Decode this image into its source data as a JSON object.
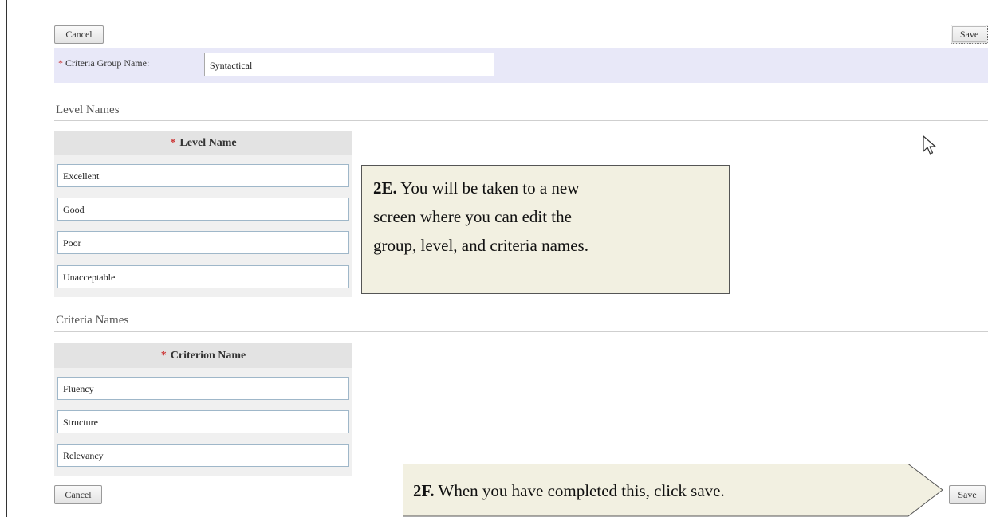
{
  "top": {
    "cancel_label": "Cancel",
    "save_label": "Save"
  },
  "group": {
    "label": "Criteria Group Name:",
    "value": "Syntactical",
    "required_mark": "*"
  },
  "levels": {
    "section_title": "Level Names",
    "column_header": "Level Name",
    "required_mark": "*",
    "rows": [
      "Excellent",
      "Good",
      "Poor",
      "Unacceptable"
    ]
  },
  "criteria": {
    "section_title": "Criteria Names",
    "column_header": "Criterion Name",
    "required_mark": "*",
    "rows": [
      "Fluency",
      "Structure",
      "Relevancy"
    ]
  },
  "bottom": {
    "cancel_label": "Cancel",
    "save_label": "Save"
  },
  "callouts": {
    "step_2e": {
      "tag": "2E.",
      "lines": [
        "You will be taken to a new",
        "screen where you can edit the",
        "group, level, and criteria names."
      ]
    },
    "step_2f": {
      "tag": "2F.",
      "text": "When you have completed this, click save."
    }
  },
  "colors": {
    "band": "#e8e8f8",
    "callout_bg": "#f2f0e1",
    "header_bg": "#e3e3e3",
    "required": "#cc3333"
  }
}
